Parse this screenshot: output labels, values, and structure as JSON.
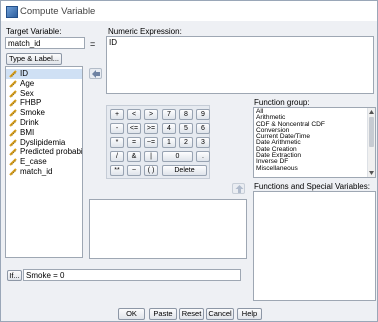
{
  "window": {
    "title": "Compute Variable"
  },
  "target": {
    "label": "Target Variable:",
    "value": "match_id",
    "type_label_button": "Type & Label..."
  },
  "expression": {
    "label": "Numeric Expression:",
    "equals": "=",
    "value": "ID"
  },
  "variables": [
    {
      "name": "ID",
      "icon": "ruler-icon",
      "selected": true
    },
    {
      "name": "Age",
      "icon": "ruler-icon"
    },
    {
      "name": "Sex",
      "icon": "ruler-icon"
    },
    {
      "name": "FHBP",
      "icon": "ruler-icon"
    },
    {
      "name": "Smoke",
      "icon": "ruler-icon"
    },
    {
      "name": "Drink",
      "icon": "ruler-icon"
    },
    {
      "name": "BMI",
      "icon": "ruler-icon"
    },
    {
      "name": "Dyslipidemia",
      "icon": "ruler-icon"
    },
    {
      "name": "Predicted probabili...",
      "icon": "ruler-icon"
    },
    {
      "name": "E_case",
      "icon": "ruler-icon"
    },
    {
      "name": "match_id",
      "icon": "ruler-icon"
    }
  ],
  "keypad": {
    "row1": [
      "+",
      "<",
      ">",
      "7",
      "8",
      "9"
    ],
    "row2": [
      "-",
      "<=",
      ">=",
      "4",
      "5",
      "6"
    ],
    "row3": [
      "*",
      "=",
      "~=",
      "1",
      "2",
      "3"
    ],
    "row4": [
      "/",
      "&",
      "|",
      "0",
      "."
    ],
    "row5": [
      "**",
      "~",
      "( )",
      "Delete"
    ]
  },
  "function_group": {
    "label": "Function group:",
    "items": [
      "All",
      "Arithmetic",
      "CDF & Noncentral CDF",
      "Conversion",
      "Current Date/Time",
      "Date Arithmetic",
      "Date Creation",
      "Date Extraction",
      "Inverse DF",
      "Miscellaneous"
    ]
  },
  "functions": {
    "label": "Functions and Special Variables:"
  },
  "if_section": {
    "button": "If...",
    "condition": "Smoke = 0"
  },
  "buttons": {
    "ok": "OK",
    "paste": "Paste",
    "reset": "Reset",
    "cancel": "Cancel",
    "help": "Help"
  },
  "colors": {
    "selection": "#cfe0f4",
    "window_bg": "#eef0f4",
    "ruler_icon": "#d8a020"
  }
}
